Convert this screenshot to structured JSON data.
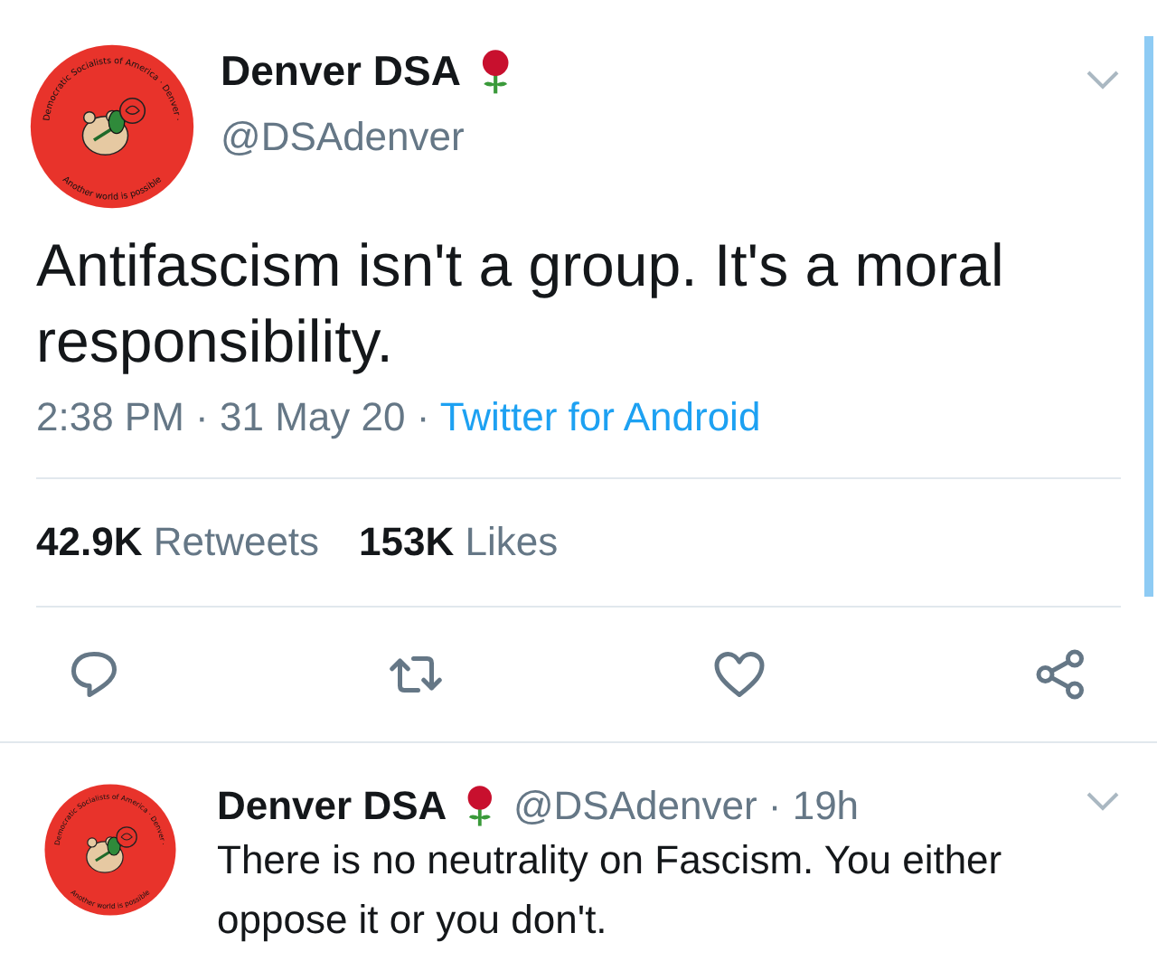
{
  "tweet": {
    "avatar": {
      "ring_top": "Democratic Socialists of America · Denver ·",
      "ring_bottom": "Another world is possible"
    },
    "name": "Denver DSA",
    "handle": "@DSAdenver",
    "text": "Antifascism isn't a group. It's a moral responsibility.",
    "time": "2:38 PM · 31 May 20 · ",
    "source": "Twitter for Android",
    "stats": [
      {
        "count": "42.9K",
        "label": "Retweets"
      },
      {
        "count": "153K",
        "label": "Likes"
      }
    ],
    "actions": [
      {
        "kind": "reply"
      },
      {
        "kind": "retweet"
      },
      {
        "kind": "like"
      },
      {
        "kind": "share"
      }
    ]
  },
  "reply": {
    "avatar": {
      "ring_top": "Democratic Socialists of America · Denver ·",
      "ring_bottom": "Another world is possible"
    },
    "name": "Denver DSA",
    "handle": "@DSAdenver · 19h",
    "text": "There is no neutrality on Fascism. You either oppose it or you don't."
  }
}
